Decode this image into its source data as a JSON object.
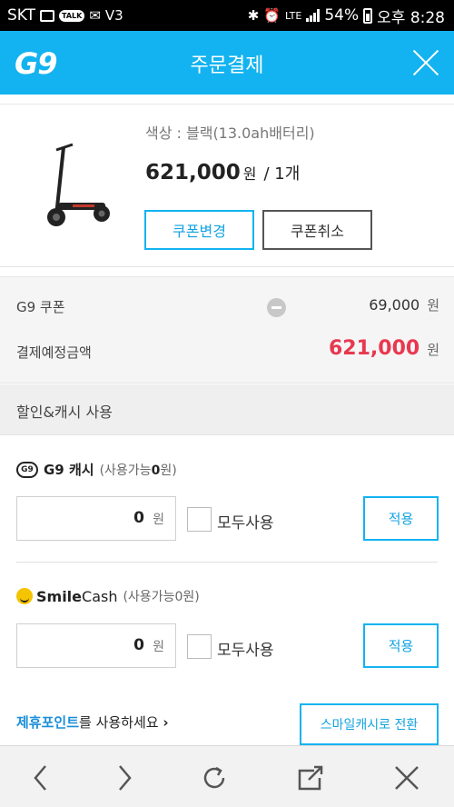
{
  "status_bar": {
    "carrier": "SKT",
    "network": "LTE",
    "battery": "54%",
    "time": "오후 8:28",
    "talk_badge": "TALK"
  },
  "header": {
    "logo": "G9",
    "title": "주문결제"
  },
  "product": {
    "option": "색상 : 블랙(13.0ah배터리)",
    "price": "621,000",
    "price_unit": "원",
    "quantity": "/ 1개",
    "coupon_change_label": "쿠폰변경",
    "coupon_cancel_label": "쿠폰취소"
  },
  "summary": {
    "coupon_label": "G9 쿠폰",
    "coupon_value": "69,000",
    "payment_label": "결제예정금액",
    "payment_value": "621,000",
    "unit": "원"
  },
  "discount": {
    "section_title": "할인&캐시 사용",
    "g9_cash": {
      "badge": "G9",
      "name": "G9 캐시",
      "available_prefix": "(사용가능",
      "available_amount": "0",
      "available_suffix": "원)",
      "amount": "0",
      "unit": "원",
      "use_all_label": "모두사용",
      "apply_label": "적용"
    },
    "smile_cash": {
      "name_bold": "Smile",
      "name_rest": "Cash",
      "available": "(사용가능0원)",
      "amount": "0",
      "unit": "원",
      "use_all_label": "모두사용",
      "apply_label": "적용"
    },
    "partner_link": "제휴포인트",
    "partner_text": "를 사용하세요",
    "partner_chevron": "›",
    "switch_label": "스마일캐시로 전환"
  },
  "nav_icons": [
    "back-icon",
    "forward-icon",
    "refresh-icon",
    "share-icon",
    "close-icon"
  ],
  "colors": {
    "accent": "#12b3f0",
    "price_red": "#e8384f",
    "link_blue": "#1a8fd8"
  }
}
